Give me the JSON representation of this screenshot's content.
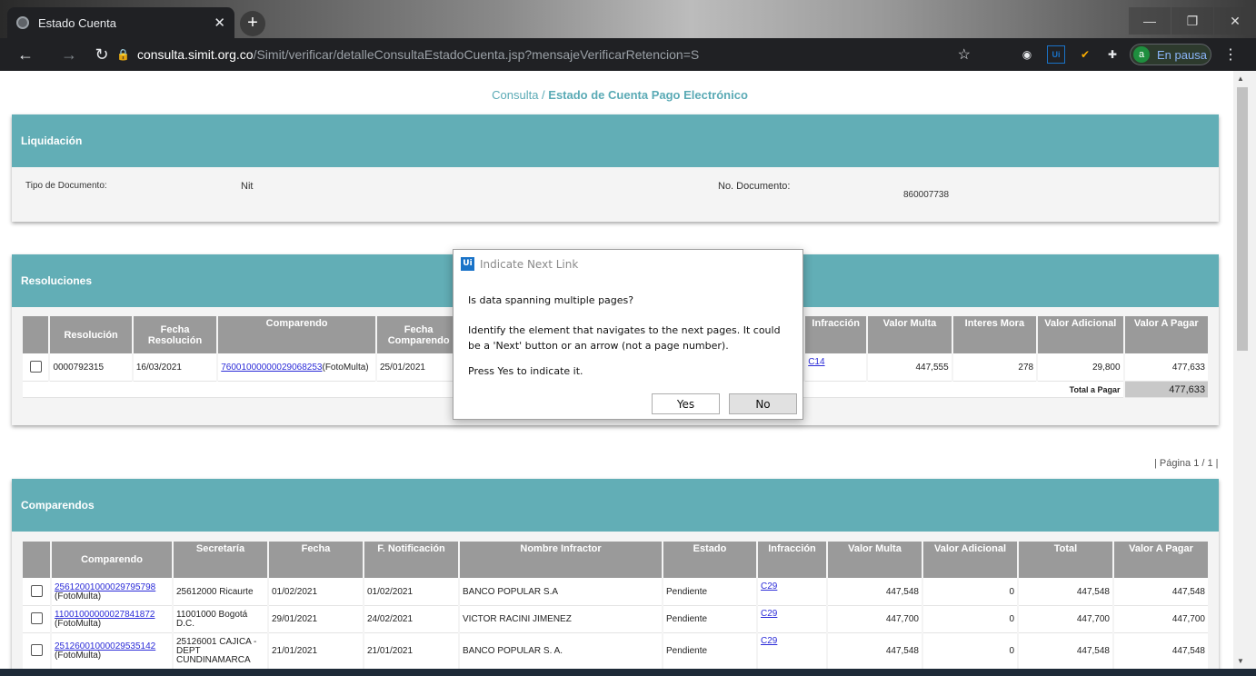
{
  "browser": {
    "tab_title": "Estado Cuenta",
    "url_host": "consulta.simit.org.co",
    "url_path": "/Simit/verificar/detalleConsultaEstadoCuenta.jsp?mensajeVerificarRetencion=S",
    "profile_initial": "a",
    "profile_label": "En pausa"
  },
  "page": {
    "breadcrumb_prefix": "Consulta /",
    "breadcrumb_title": "Estado de Cuenta Pago Electrónico"
  },
  "liquidacion": {
    "header": "Liquidación",
    "tipo_label": "Tipo de Documento:",
    "tipo_value": "Nit",
    "doc_label": "No. Documento:",
    "doc_value": "860007738"
  },
  "resoluciones": {
    "header": "Resoluciones",
    "columns": [
      "Resolución",
      "Fecha Resolución",
      "Comparendo",
      "Fecha Comparendo",
      "Infracción",
      "Valor Multa",
      "Interes Mora",
      "Valor Adicional",
      "Valor A Pagar"
    ],
    "rows": [
      {
        "resolucion": "0000792315",
        "fecha_resolucion": "16/03/2021",
        "comparendo": "76001000000029068253",
        "comparendo_tipo": "(FotoMulta)",
        "fecha_comparendo": "25/01/2021",
        "infraccion": "C14",
        "valor_multa": "447,555",
        "interes_mora": "278",
        "valor_adicional": "29,800",
        "valor_pagar": "477,633"
      }
    ],
    "total_label": "Total a Pagar",
    "total_value": "477,633"
  },
  "pager": {
    "label": "| Página 1 / 1 |"
  },
  "comparendos": {
    "header": "Comparendos",
    "columns": [
      "Comparendo",
      "Secretaría",
      "Fecha",
      "F. Notificación",
      "Nombre Infractor",
      "Estado",
      "Infracción",
      "Valor Multa",
      "Valor Adicional",
      "Total",
      "Valor A Pagar"
    ],
    "rows": [
      {
        "comparendo": "25612001000029795798",
        "tipo": "(FotoMulta)",
        "secretaria": "25612000 Ricaurte",
        "fecha": "01/02/2021",
        "notificacion": "01/02/2021",
        "infractor": "BANCO POPULAR S.A",
        "estado": "Pendiente",
        "infraccion": "C29",
        "multa": "447,548",
        "adicional": "0",
        "total": "447,548",
        "pagar": "447,548"
      },
      {
        "comparendo": "11001000000027841872",
        "tipo": "(FotoMulta)",
        "secretaria": "11001000 Bogotá D.C.",
        "fecha": "29/01/2021",
        "notificacion": "24/02/2021",
        "infractor": "VICTOR RACINI JIMENEZ",
        "estado": "Pendiente",
        "infraccion": "C29",
        "multa": "447,700",
        "adicional": "0",
        "total": "447,700",
        "pagar": "447,700"
      },
      {
        "comparendo": "25126001000029535142",
        "tipo": "(FotoMulta)",
        "secretaria": "25126001 CAJICA - DEPT CUNDINAMARCA",
        "fecha": "21/01/2021",
        "notificacion": "21/01/2021",
        "infractor": "BANCO POPULAR S. A.",
        "estado": "Pendiente",
        "infraccion": "C29",
        "multa": "447,548",
        "adicional": "0",
        "total": "447,548",
        "pagar": "447,548"
      }
    ]
  },
  "dialog": {
    "title": "Indicate Next Link",
    "logo": "Ui",
    "question": "Is data spanning multiple pages?",
    "body": "Identify the element that navigates to the next pages. It could be a 'Next' button or an arrow (not a page number).",
    "press": "Press Yes to indicate it.",
    "yes_label": "Yes",
    "no_label": "No"
  }
}
